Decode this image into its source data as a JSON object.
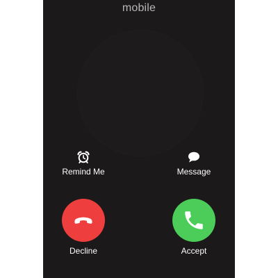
{
  "header": {
    "caller_label": "mobile"
  },
  "actions": {
    "remind_label": "Remind Me",
    "message_label": "Message",
    "decline_label": "Decline",
    "accept_label": "Accept"
  },
  "icons": {
    "remind": "alarm-clock-icon",
    "message": "speech-bubble-icon",
    "decline": "phone-hangup-icon",
    "accept": "phone-icon"
  },
  "colors": {
    "background": "#1b1919",
    "decline": "#ee3f3e",
    "accept": "#4ccc59",
    "caller_label": "#b8b6b6"
  }
}
